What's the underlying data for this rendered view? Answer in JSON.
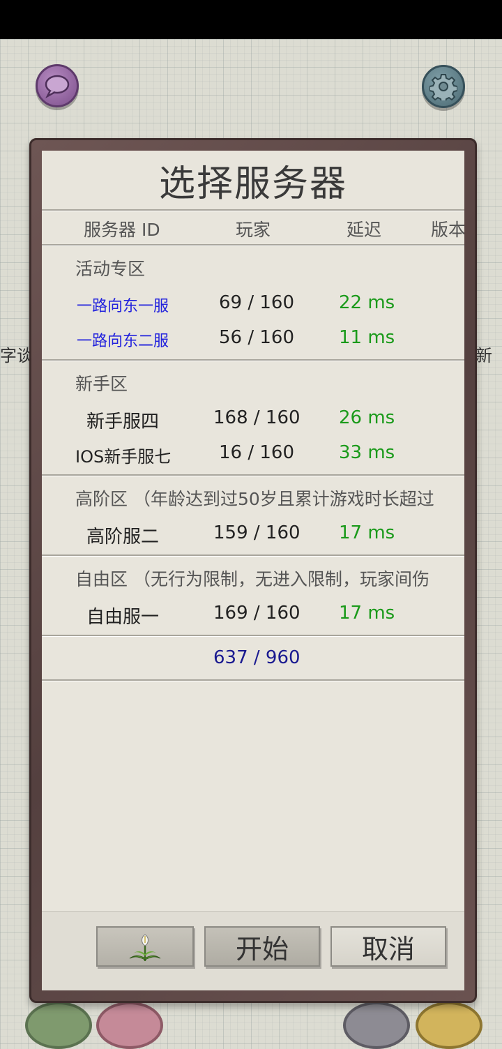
{
  "dialog": {
    "title": "选择服务器",
    "columns": [
      "服务器 ID",
      "玩家",
      "延迟",
      "版本"
    ],
    "sections": [
      {
        "title": "活动专区",
        "servers": [
          {
            "name": "一路向东一服",
            "players": "69 / 160",
            "latency": "22 ms"
          },
          {
            "name": "一路向东二服",
            "players": "56 / 160",
            "latency": "11 ms"
          }
        ]
      },
      {
        "title": "新手区",
        "servers": [
          {
            "name": "新手服四",
            "players": "168 / 160",
            "latency": "26 ms"
          },
          {
            "name": "IOS新手服七",
            "players": "16 / 160",
            "latency": "33 ms"
          }
        ]
      },
      {
        "title": "高阶区 （年龄达到过50岁且累计游戏时长超过",
        "servers": [
          {
            "name": "高阶服二",
            "players": "159 / 160",
            "latency": "17 ms"
          }
        ]
      },
      {
        "title": "自由区 （无行为限制，无进入限制，玩家间伤",
        "servers": [
          {
            "name": "自由服一",
            "players": "169 / 160",
            "latency": "17 ms"
          }
        ]
      }
    ],
    "total": "637 / 960",
    "buttons": {
      "icon": "plant-icon",
      "start": "开始",
      "cancel": "取消"
    }
  },
  "background": {
    "left_text": "字谈",
    "right_text": "新"
  },
  "colors": {
    "link": "#2222dd",
    "latency": "#1a9a1a",
    "total": "#1a1a90",
    "frame": "#5c4644"
  }
}
